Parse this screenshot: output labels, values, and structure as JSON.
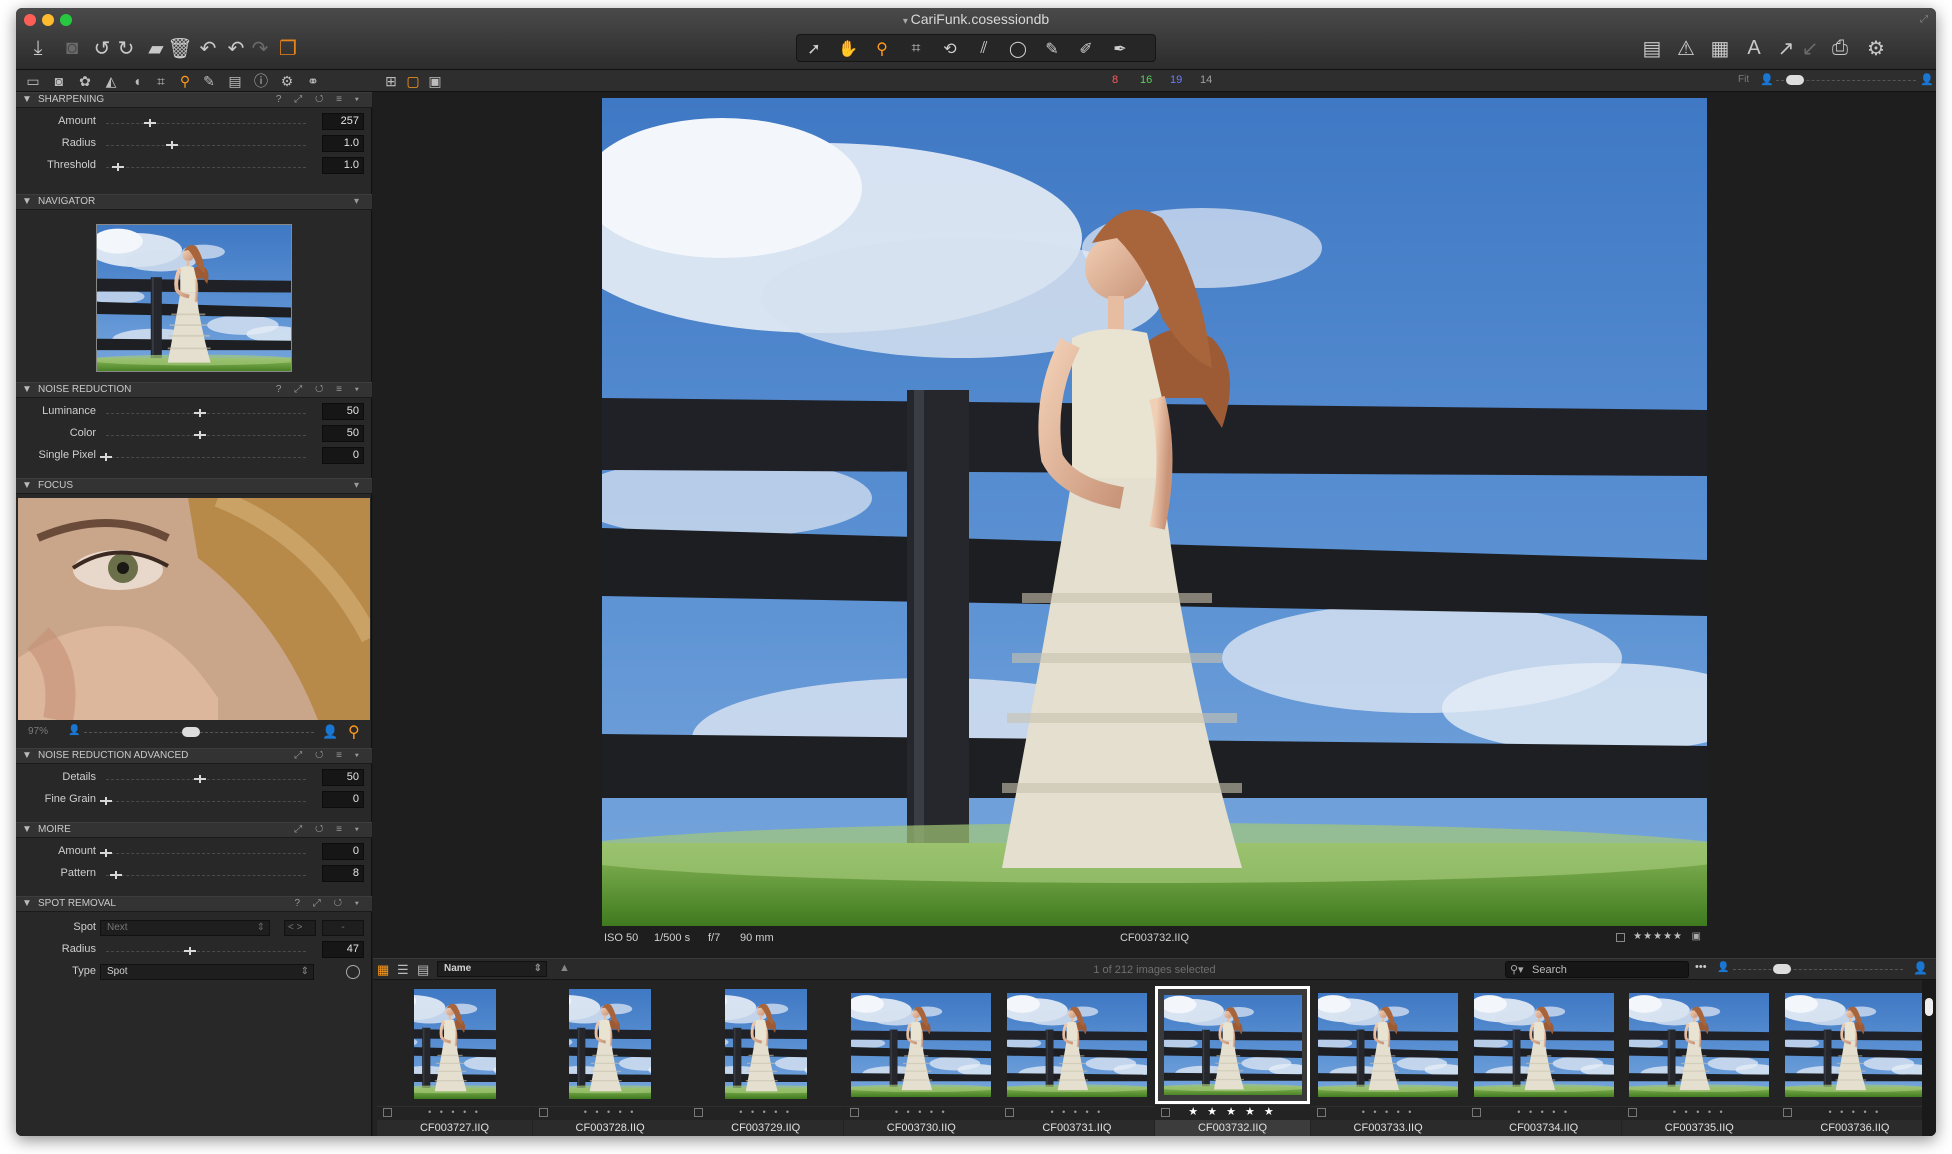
{
  "window": {
    "title": "CariFunk.cosessiondb"
  },
  "toolbar_left": [
    "import-icon",
    "camera-icon",
    "rotate-left-icon",
    "rotate-right-icon",
    "move-to-icon",
    "trash-icon",
    "undo-icon",
    "redo-icon",
    "redo-disabled-icon",
    "variants-icon"
  ],
  "tools": [
    "select-icon",
    "pan-icon",
    "loupe-icon",
    "crop-icon",
    "rotate-icon",
    "keystone-icon",
    "spot-removal-icon",
    "brush-icon",
    "eraser-icon",
    "picker-icon"
  ],
  "subbar": {
    "counts": {
      "red": "8",
      "green": "16",
      "blue": "19",
      "white": "14"
    },
    "colors": {
      "red": "#ff5a5a",
      "green": "#58d058",
      "blue": "#6a7cff",
      "white": "#a0a0a0",
      "accent": "#ff9b1a"
    },
    "fit_label": "Fit"
  },
  "sharpening": {
    "title": "SHARPENING",
    "rows": [
      {
        "label": "Amount",
        "value": "257",
        "pos": 0.22
      },
      {
        "label": "Radius",
        "value": "1.0",
        "pos": 0.33
      },
      {
        "label": "Threshold",
        "value": "1.0",
        "pos": 0.06
      }
    ]
  },
  "navigator": {
    "title": "NAVIGATOR"
  },
  "noise_reduction": {
    "title": "NOISE REDUCTION",
    "rows": [
      {
        "label": "Luminance",
        "value": "50",
        "pos": 0.47
      },
      {
        "label": "Color",
        "value": "50",
        "pos": 0.47
      },
      {
        "label": "Single Pixel",
        "value": "0",
        "pos": 0.0
      }
    ]
  },
  "focus": {
    "title": "FOCUS",
    "zoom": "97%"
  },
  "noise_reduction_advanced": {
    "title": "NOISE REDUCTION ADVANCED",
    "rows": [
      {
        "label": "Details",
        "value": "50",
        "pos": 0.47
      },
      {
        "label": "Fine Grain",
        "value": "0",
        "pos": 0.0
      }
    ]
  },
  "moire": {
    "title": "MOIRE",
    "rows": [
      {
        "label": "Amount",
        "value": "0",
        "pos": 0.0
      },
      {
        "label": "Pattern",
        "value": "8",
        "pos": 0.05
      }
    ]
  },
  "spot_removal": {
    "title": "SPOT REMOVAL",
    "spot_label": "Spot",
    "spot_value": "Next",
    "radius_label": "Radius",
    "radius_value": "47",
    "radius_pos": 0.42,
    "type_label": "Type",
    "type_value": "Spot"
  },
  "viewer": {
    "iso": "ISO 50",
    "shutter": "1/500 s",
    "aperture": "f/7",
    "focal": "90 mm",
    "filename": "CF003732.IIQ",
    "stars": "★★★★★"
  },
  "browser": {
    "sort_label": "Name",
    "selection_text": "1 of 212 images selected",
    "search_placeholder": "Search"
  },
  "thumbnails": [
    {
      "name": "CF003727.IIQ",
      "orientation": "portrait",
      "rating": "• • • • •",
      "selected": false
    },
    {
      "name": "CF003728.IIQ",
      "orientation": "portrait",
      "rating": "• • • • •",
      "selected": false
    },
    {
      "name": "CF003729.IIQ",
      "orientation": "portrait",
      "rating": "• • • • •",
      "selected": false
    },
    {
      "name": "CF003730.IIQ",
      "orientation": "landscape",
      "rating": "• • • • •",
      "selected": false
    },
    {
      "name": "CF003731.IIQ",
      "orientation": "landscape",
      "rating": "• • • • •",
      "selected": false
    },
    {
      "name": "CF003732.IIQ",
      "orientation": "landscape",
      "rating": "★ ★ ★ ★ ★",
      "selected": true
    },
    {
      "name": "CF003733.IIQ",
      "orientation": "landscape",
      "rating": "• • • • •",
      "selected": false
    },
    {
      "name": "CF003734.IIQ",
      "orientation": "landscape",
      "rating": "• • • • •",
      "selected": false
    },
    {
      "name": "CF003735.IIQ",
      "orientation": "landscape",
      "rating": "• • • • •",
      "selected": false
    },
    {
      "name": "CF003736.IIQ",
      "orientation": "landscape",
      "rating": "• • • • •",
      "selected": false
    }
  ]
}
